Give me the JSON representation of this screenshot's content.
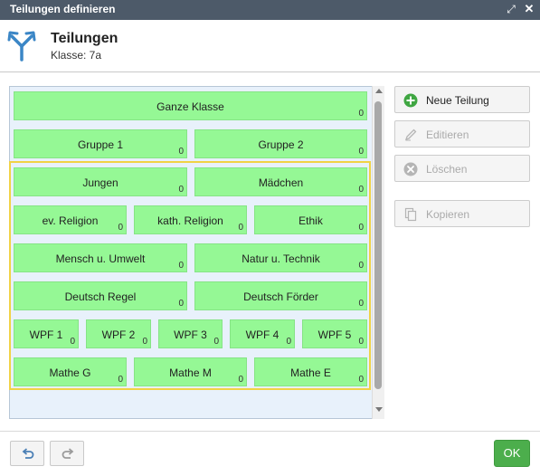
{
  "window": {
    "title": "Teilungen definieren",
    "expand_icon": "expand-icon",
    "close_icon": "close-icon"
  },
  "header": {
    "title": "Teilungen",
    "subtitle": "Klasse: 7a",
    "icon": "split-arrows-icon"
  },
  "tiles": [
    {
      "label": "Ganze Klasse",
      "count": "0"
    },
    {
      "label": "Gruppe 1",
      "count": "0"
    },
    {
      "label": "Gruppe 2",
      "count": "0"
    },
    {
      "label": "Jungen",
      "count": "0"
    },
    {
      "label": "Mädchen",
      "count": "0"
    },
    {
      "label": "ev. Religion",
      "count": "0"
    },
    {
      "label": "kath. Religion",
      "count": "0"
    },
    {
      "label": "Ethik",
      "count": "0"
    },
    {
      "label": "Mensch u. Umwelt",
      "count": "0"
    },
    {
      "label": "Natur u. Technik",
      "count": "0"
    },
    {
      "label": "Deutsch Regel",
      "count": "0"
    },
    {
      "label": "Deutsch Förder",
      "count": "0"
    },
    {
      "label": "WPF 1",
      "count": "0"
    },
    {
      "label": "WPF 2",
      "count": "0"
    },
    {
      "label": "WPF 3",
      "count": "0"
    },
    {
      "label": "WPF 4",
      "count": "0"
    },
    {
      "label": "WPF 5",
      "count": "0"
    },
    {
      "label": "Mathe G",
      "count": "0"
    },
    {
      "label": "Mathe M",
      "count": "0"
    },
    {
      "label": "Mathe E",
      "count": "0"
    }
  ],
  "actions": {
    "new": {
      "label": "Neue Teilung",
      "icon": "plus-circle-icon",
      "enabled": true
    },
    "edit": {
      "label": "Editieren",
      "icon": "pencil-icon",
      "enabled": false
    },
    "delete": {
      "label": "Löschen",
      "icon": "x-circle-icon",
      "enabled": false
    },
    "copy": {
      "label": "Kopieren",
      "icon": "copy-icon",
      "enabled": false
    }
  },
  "footer": {
    "undo_icon": "undo-icon",
    "redo_icon": "redo-icon",
    "ok_label": "OK"
  },
  "colors": {
    "titlebar": "#4d5a69",
    "tile": "#95f895",
    "highlight_border": "#f1d245",
    "ok": "#4cae4c",
    "add_icon": "#3fa642"
  }
}
